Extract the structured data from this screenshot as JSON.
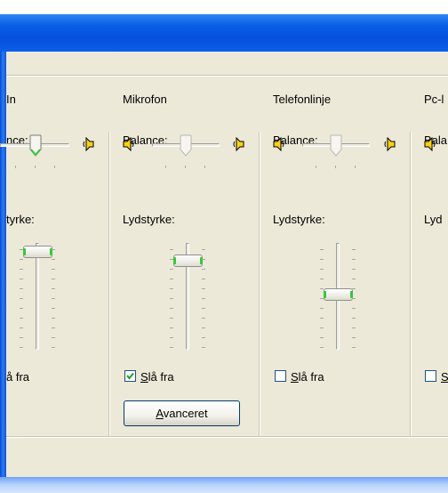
{
  "channels": [
    {
      "name": "In",
      "balance_label": "nce:",
      "volume_label": "tyrke:",
      "mute_label": "å fra",
      "mute_checked": false
    },
    {
      "name": "Mikrofon",
      "balance_label": "Balance:",
      "volume_label": "Lydstyrke:",
      "mute_label_u": "S",
      "mute_label_rest": "lå fra",
      "mute_checked": true,
      "advanced_u": "A",
      "advanced_rest": "vanceret"
    },
    {
      "name": "Telefonlinje",
      "balance_label": "Balance:",
      "volume_label": "Lydstyrke:",
      "mute_label_u": "S",
      "mute_label_rest": "lå fra",
      "mute_checked": false
    },
    {
      "name": "Pc-l",
      "balance_label": "Bala",
      "volume_label": "Lyd",
      "mute_label_u": "S",
      "mute_checked": false
    }
  ],
  "slider_levels": {
    "in_volume": 1.0,
    "mikrofon_volume": 0.85,
    "telefonlinje_volume": 0.5,
    "in_balance": 0.5,
    "mikrofon_balance": 0.5,
    "telefonlinje_balance": 0.5
  },
  "colors": {
    "titlebar": "#0a5ee6",
    "dialog": "#ece9d8",
    "thumb_accent": "#34c83a",
    "check": "#21a121"
  },
  "icons": [
    "speaker-left-icon",
    "speaker-right-icon",
    "checkmark-icon"
  ]
}
